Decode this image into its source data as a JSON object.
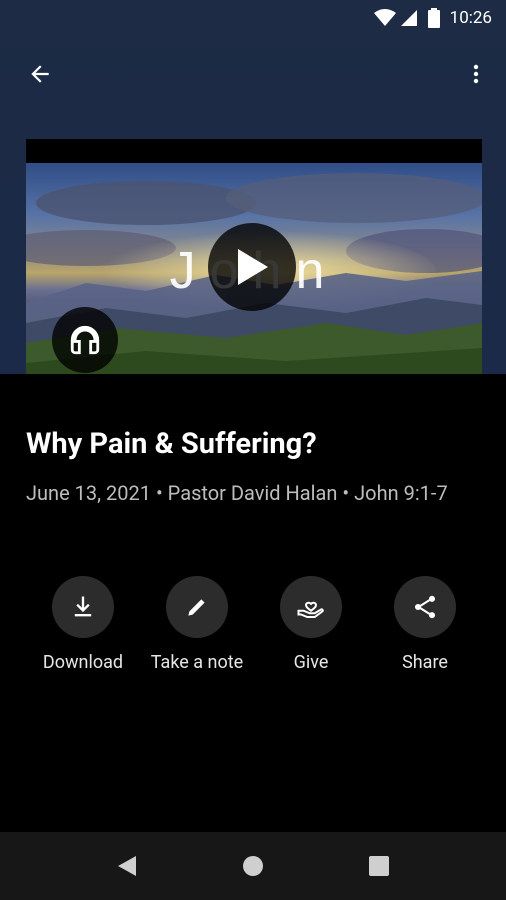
{
  "status_bar": {
    "time": "10:26"
  },
  "media": {
    "artwork_title": "John"
  },
  "sermon": {
    "title": "Why Pain & Suffering?",
    "meta": "June 13, 2021 • Pastor David Halan • John 9:1-7"
  },
  "actions": [
    {
      "label": "Download",
      "icon": "download-icon"
    },
    {
      "label": "Take a note",
      "icon": "pencil-icon"
    },
    {
      "label": "Give",
      "icon": "give-hand-heart-icon"
    },
    {
      "label": "Share",
      "icon": "share-icon"
    }
  ],
  "colors": {
    "header_bg": "#1b2a46",
    "page_bg": "#000000",
    "button_bg": "#2c2c2c",
    "meta_text": "#bdbdbd"
  }
}
